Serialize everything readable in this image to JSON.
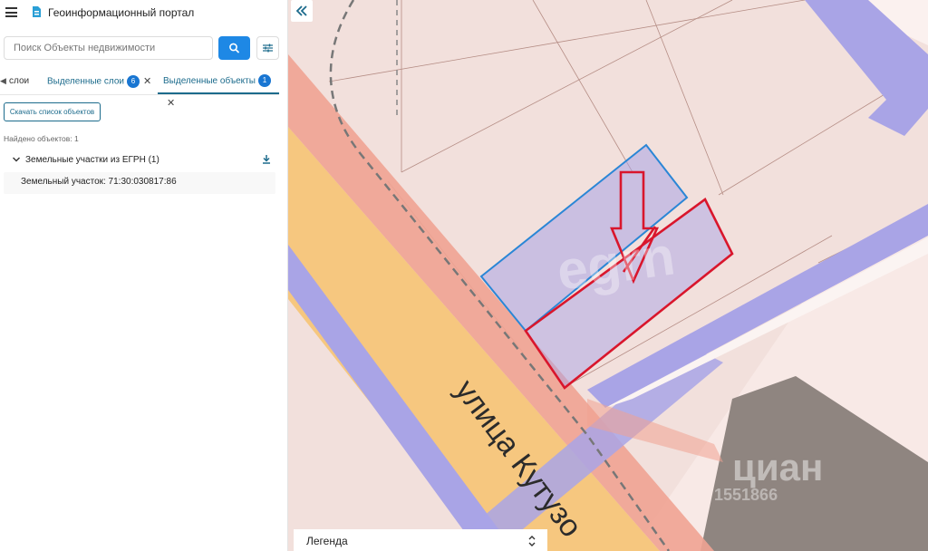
{
  "app": {
    "title": "Геоинформационный портал"
  },
  "search": {
    "placeholder": "Поиск Объекты недвижимости"
  },
  "tabs": {
    "items": [
      {
        "label": "слои"
      },
      {
        "label": "Выделенные слои",
        "badge": "6"
      },
      {
        "label": "Выделенные объекты",
        "badge": "1"
      }
    ]
  },
  "results": {
    "download_label": "Скачать список объектов",
    "found_text": "Найдено объектов: 1",
    "group_title": "Земельные участки из ЕГРН (1)",
    "item_text": "Земельный участок: 71:30:030817:86"
  },
  "map": {
    "street_label": "улица Кутузо",
    "watermark_center": "egrn",
    "watermark_cian": "циан",
    "watermark_id": "1551866",
    "legend_label": "Легенда"
  },
  "colors": {
    "accent": "#1e88e5",
    "teal": "#1c6b8c",
    "map_bg": "#f2e0dc",
    "road_yellow": "#f6c77f",
    "road_salmon": "#f0a392",
    "road_purple": "#a9a4e6",
    "selection_blue": "#2a86d6",
    "selection_red": "#d9162c"
  },
  "icons": {
    "menu": "menu-icon",
    "logo": "logo-icon",
    "search": "search-icon",
    "filter": "filter-icon",
    "download": "download-icon",
    "chevron": "chevron-down-icon",
    "collapse": "double-chevron-left-icon",
    "sort": "sort-icon"
  }
}
